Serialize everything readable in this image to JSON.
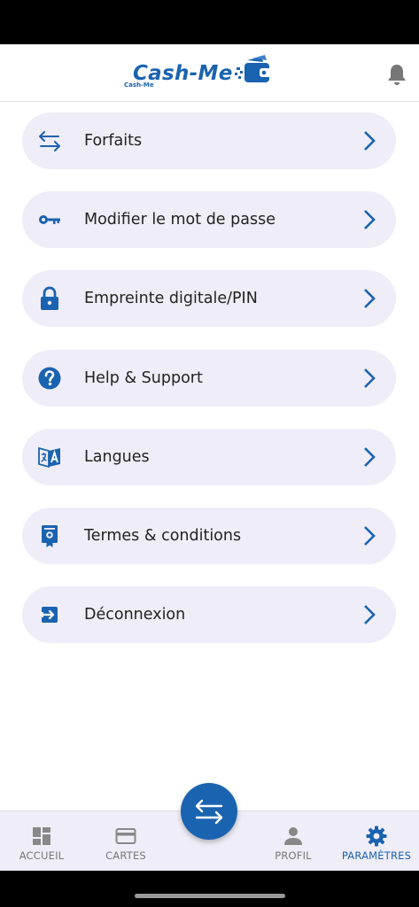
{
  "app": {
    "logo_text": "Cash-Me",
    "logo_sub": "Cash-Me",
    "brand_color": "#1a63b0"
  },
  "header": {
    "notification_icon": "bell-icon"
  },
  "menu": {
    "items": [
      {
        "label": "Forfaits",
        "icon": "transfer-arrows-icon"
      },
      {
        "label": "Modifier le mot de passe",
        "icon": "key-icon"
      },
      {
        "label": "Empreinte digitale/PIN",
        "icon": "lock-icon"
      },
      {
        "label": "Help & Support",
        "icon": "help-circle-icon"
      },
      {
        "label": "Langues",
        "icon": "translate-icon"
      },
      {
        "label": "Termes & conditions",
        "icon": "certificate-icon"
      },
      {
        "label": "Déconnexion",
        "icon": "logout-icon"
      }
    ]
  },
  "bottom_nav": {
    "items": [
      {
        "label": "ACCUEIL",
        "icon": "dashboard-icon",
        "active": false
      },
      {
        "label": "CARTES",
        "icon": "card-icon",
        "active": false
      },
      {
        "label": "PROFIL",
        "icon": "person-icon",
        "active": false
      },
      {
        "label": "PARAMÈTRES",
        "icon": "gear-icon",
        "active": true
      }
    ],
    "fab_icon": "transfer-arrows-icon"
  }
}
